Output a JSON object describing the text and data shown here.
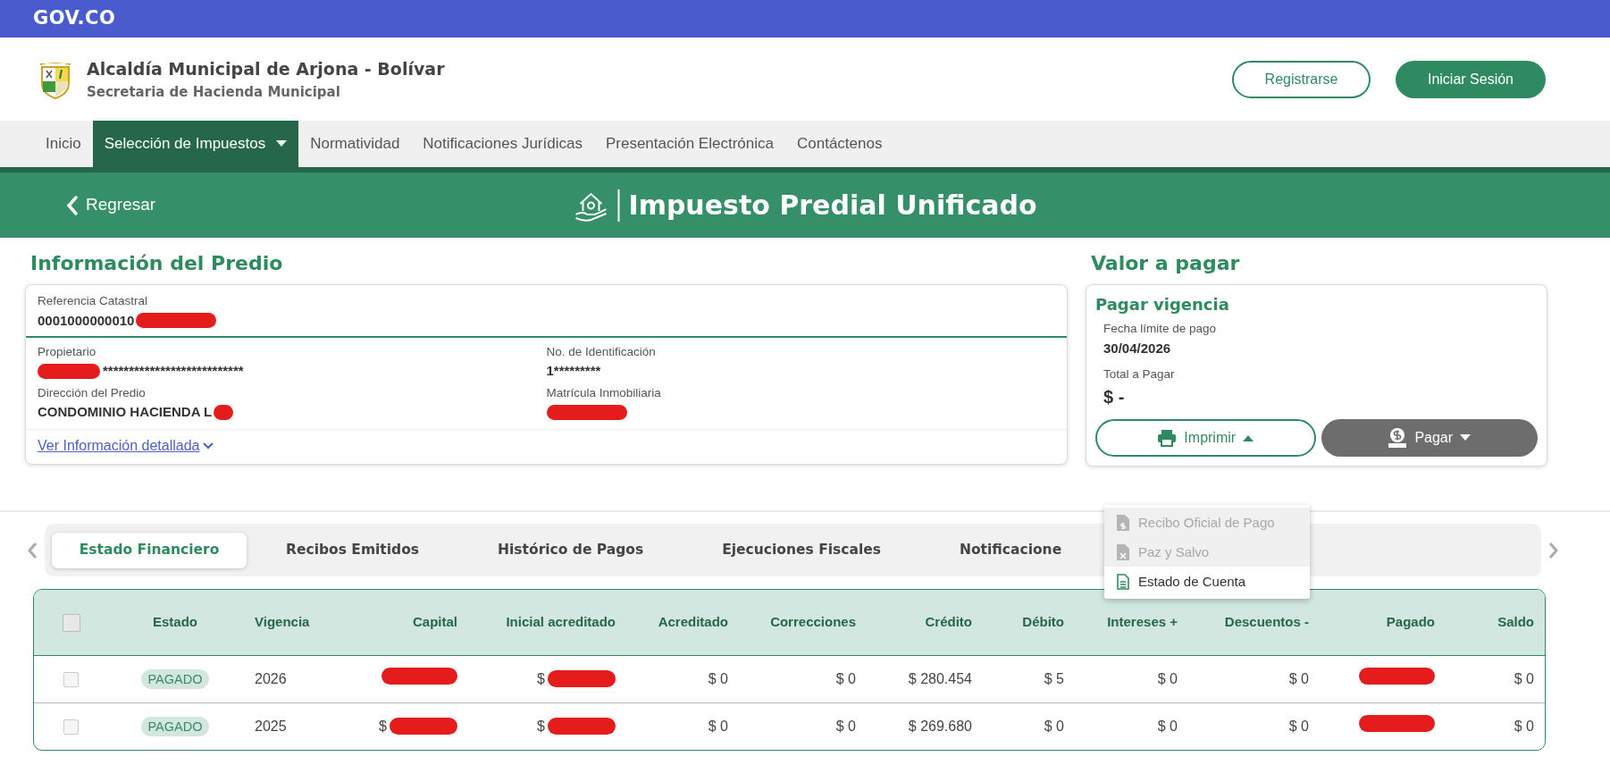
{
  "gov_bar": {
    "logo": "GOV.CO"
  },
  "header": {
    "title": "Alcaldía Municipal de Arjona - Bolívar",
    "subtitle": "Secretaria de Hacienda Municipal",
    "buttons": [
      {
        "label": "Registrarse",
        "kind": "outline"
      },
      {
        "label": "Iniciar Sesión",
        "kind": "solid"
      }
    ]
  },
  "nav": [
    {
      "label": "Inicio",
      "selected": false
    },
    {
      "label": "Selección de Impuestos",
      "selected": true,
      "dropdown": true
    },
    {
      "label": "Normatividad",
      "selected": false
    },
    {
      "label": "Notificaciones Jurídicas",
      "selected": false
    },
    {
      "label": "Presentación Electrónica",
      "selected": false
    },
    {
      "label": "Contáctenos",
      "selected": false
    }
  ],
  "banner": {
    "back": "Regresar",
    "title": "Impuesto Predial Unificado"
  },
  "property": {
    "heading": "Información del Predio",
    "reference": {
      "label": "Referencia Catastral",
      "value": "0001000000010",
      "redacted": true
    },
    "fields": [
      {
        "label": "Propietario",
        "value": "***************************",
        "redacted_prefix": true
      },
      {
        "label": "No. de Identificación",
        "value": "1*********"
      },
      {
        "label": "Dirección del Predio",
        "value": "CONDOMINIO HACIENDA L",
        "redacted": true
      },
      {
        "label": "Matrícula Inmobiliaria",
        "redacted": true
      }
    ],
    "link": "Ver Información detallada"
  },
  "payment": {
    "heading": "Valor a pagar",
    "card_title": "Pagar vigencia",
    "fields": [
      {
        "label": "Fecha límite de pago",
        "value": "30/04/2026",
        "kind": "date"
      },
      {
        "label": "Total a Pagar",
        "value": "$ -",
        "kind": "total"
      }
    ],
    "print_button": {
      "label": "Imprimir",
      "expanded": true
    },
    "pay_button": {
      "label": "Pagar",
      "expanded": false
    },
    "print_menu": [
      {
        "label": "Recibo Oficial de Pago",
        "disabled": true,
        "kind": "receipt"
      },
      {
        "label": "Paz y Salvo",
        "disabled": true,
        "kind": "certificate"
      },
      {
        "label": "Estado de Cuenta",
        "disabled": false,
        "kind": "statement"
      }
    ]
  },
  "tabs": [
    {
      "label": "Estado Financiero",
      "selected": true
    },
    {
      "label": "Recibos Emitidos",
      "selected": false
    },
    {
      "label": "Histórico de Pagos",
      "selected": false
    },
    {
      "label": "Ejecuciones Fiscales",
      "selected": false
    },
    {
      "label": "Notificacione",
      "selected": false
    }
  ],
  "table": {
    "header_checked": false,
    "columns": [
      "Estado",
      "Vigencia",
      "Capital",
      "Inicial acreditado",
      "Acreditado",
      "Correcciones",
      "Crédito",
      "Débito",
      "Intereses +",
      "Descuentos -",
      "Pagado",
      "Saldo"
    ],
    "rows": [
      {
        "checked": false,
        "cells": [
          {
            "text": "PAGADO",
            "kind": "badge"
          },
          {
            "text": "2026"
          },
          {
            "redacted": true
          },
          {
            "text": "$",
            "redacted": true
          },
          {
            "text": "$ 0"
          },
          {
            "text": "$ 0"
          },
          {
            "text": "$ 280.454"
          },
          {
            "text": "$ 5"
          },
          {
            "text": "$ 0"
          },
          {
            "text": "$ 0"
          },
          {
            "redacted": true
          },
          {
            "text": "$ 0"
          }
        ]
      },
      {
        "checked": false,
        "cells": [
          {
            "text": "PAGADO",
            "kind": "badge"
          },
          {
            "text": "2025"
          },
          {
            "text": "$",
            "redacted": true
          },
          {
            "text": "$",
            "redacted": true
          },
          {
            "text": "$ 0"
          },
          {
            "text": "$ 0"
          },
          {
            "text": "$ 269.680"
          },
          {
            "text": "$ 0"
          },
          {
            "text": "$ 0"
          },
          {
            "text": "$ 0"
          },
          {
            "redacted": true
          },
          {
            "text": "$ 0"
          }
        ]
      }
    ]
  }
}
